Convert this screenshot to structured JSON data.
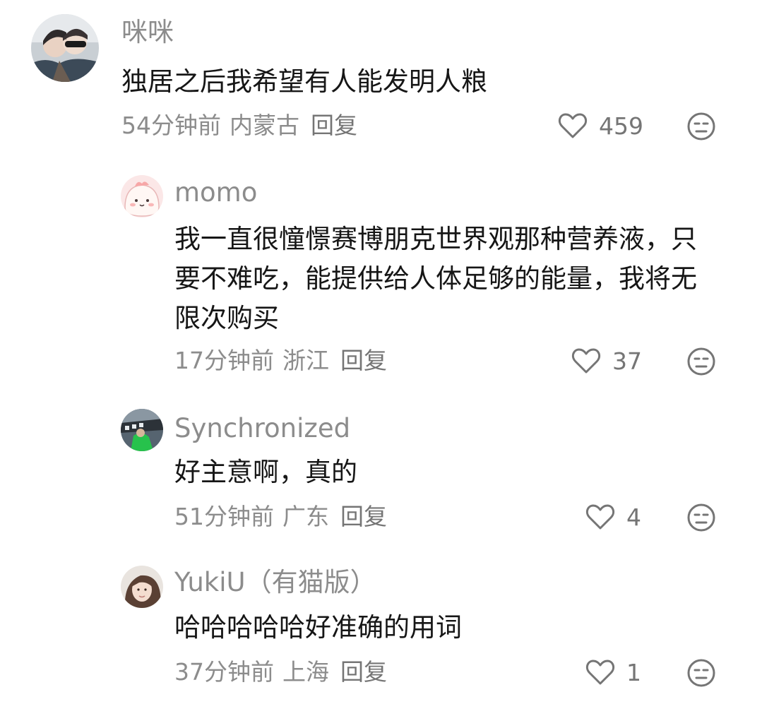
{
  "comments": [
    {
      "username": "咪咪",
      "text": "独居之后我希望有人能发明人粮",
      "time": "54分钟前",
      "location": "内蒙古",
      "reply": "回复",
      "likes": "459"
    },
    {
      "username": "momo",
      "text": "我一直很憧憬赛博朋克世界观那种营养液，只要不难吃，能提供给人体足够的能量，我将无限次购买",
      "time": "17分钟前",
      "location": "浙江",
      "reply": "回复",
      "likes": "37"
    },
    {
      "username": "Synchronized",
      "text": "好主意啊，真的",
      "time": "51分钟前",
      "location": "广东",
      "reply": "回复",
      "likes": "4"
    },
    {
      "username": "YukiU（有猫版）",
      "text": "哈哈哈哈哈好准确的用词",
      "time": "37分钟前",
      "location": "上海",
      "reply": "回复",
      "likes": "1"
    }
  ],
  "colors": {
    "text": "#161616",
    "secondary": "#8c8c8c",
    "icon": "#757575"
  },
  "icons": {
    "like": "heart-outline-icon",
    "dislike": "unamused-face-icon"
  }
}
